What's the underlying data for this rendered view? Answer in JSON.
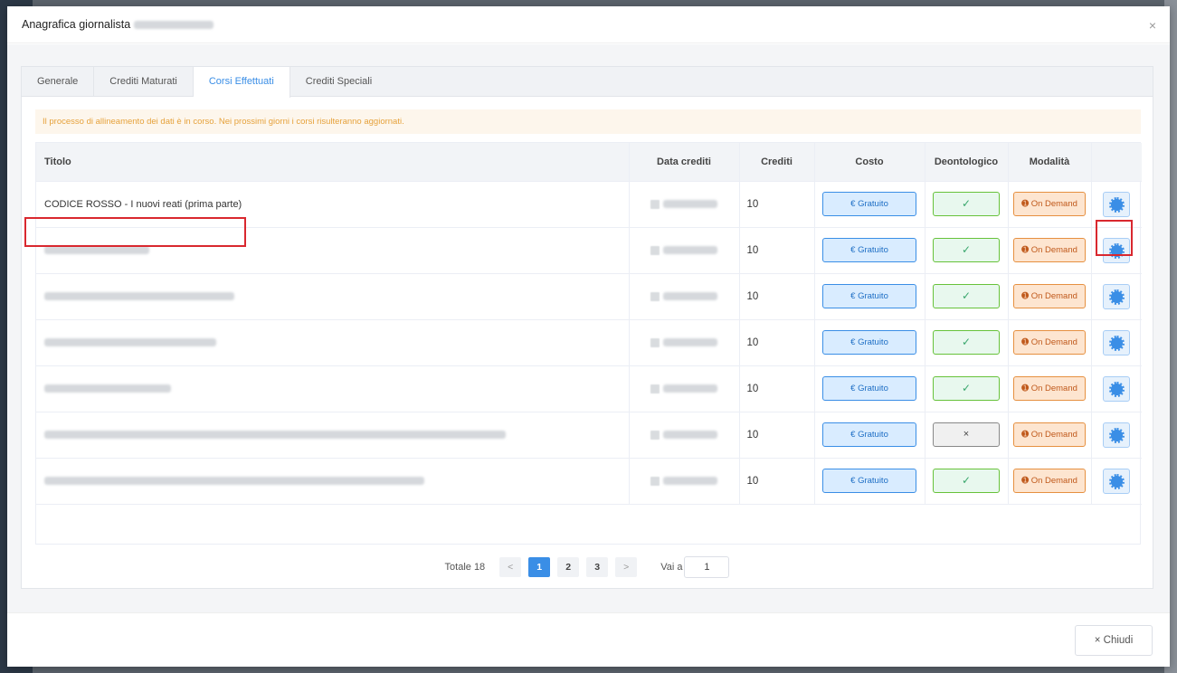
{
  "modal": {
    "title": "Anagrafica giornalista",
    "close_label": "Chiudi",
    "close_icon": "×"
  },
  "tabs": [
    {
      "label": "Generale"
    },
    {
      "label": "Crediti Maturati"
    },
    {
      "label": "Corsi Effettuati"
    },
    {
      "label": "Crediti Speciali"
    }
  ],
  "alert": "Il processo di allineamento dei dati è in corso. Nei prossimi giorni i corsi risulteranno aggiornati.",
  "table": {
    "headers": {
      "titolo": "Titolo",
      "data": "Data crediti",
      "crediti": "Crediti",
      "costo": "Costo",
      "deontologico": "Deontologico",
      "modalita": "Modalità"
    },
    "rows": [
      {
        "title": "CODICE ROSSO - I nuovi reati (prima parte)",
        "crediti": "10",
        "costo": "€ Gratuito",
        "deo": "✓",
        "modalita": "On Demand"
      },
      {
        "title": "",
        "crediti": "10",
        "costo": "€ Gratuito",
        "deo": "✓",
        "modalita": "On Demand"
      },
      {
        "title": "",
        "crediti": "10",
        "costo": "€ Gratuito",
        "deo": "✓",
        "modalita": "On Demand"
      },
      {
        "title": "",
        "crediti": "10",
        "costo": "€ Gratuito",
        "deo": "✓",
        "modalita": "On Demand"
      },
      {
        "title": "",
        "crediti": "10",
        "costo": "€ Gratuito",
        "deo": "✓",
        "modalita": "On Demand"
      },
      {
        "title": "",
        "crediti": "10",
        "costo": "€ Gratuito",
        "deo": "×",
        "modalita": "On Demand"
      },
      {
        "title": "",
        "crediti": "10",
        "costo": "€ Gratuito",
        "deo": "✓",
        "modalita": "On Demand"
      }
    ]
  },
  "pagination": {
    "total": "Totale 18",
    "pages": [
      "1",
      "2",
      "3"
    ],
    "prev": "<",
    "next": ">",
    "goto_label": "Vai a",
    "goto_value": "1"
  }
}
